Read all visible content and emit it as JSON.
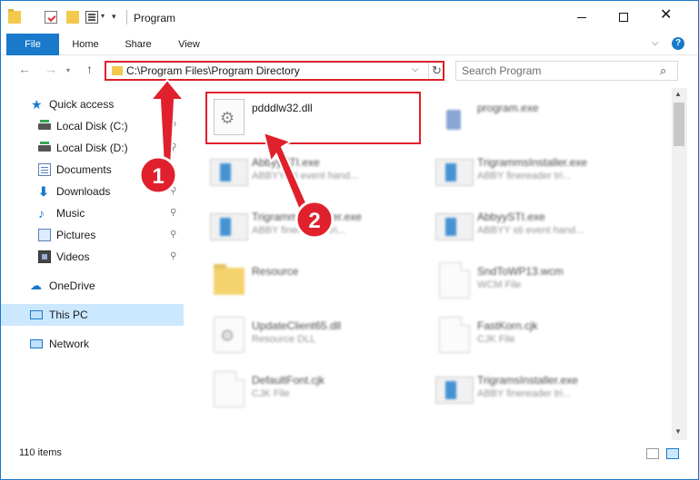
{
  "window": {
    "title": "Program",
    "min_glyph": "",
    "close_glyph": "✕"
  },
  "ribbon": {
    "tabs": [
      {
        "label": "File"
      },
      {
        "label": "Home"
      },
      {
        "label": "Share"
      },
      {
        "label": "View"
      }
    ],
    "help_glyph": "?"
  },
  "nav": {
    "back_glyph": "←",
    "forward_glyph": "→",
    "recent_glyph": "▾",
    "up_glyph": "↑"
  },
  "address": {
    "path": "C:\\Program Files\\Program Directory",
    "dropdown_glyph": "⌵",
    "refresh_glyph": "↻"
  },
  "search": {
    "placeholder": "Search Program",
    "icon_glyph": "⌕"
  },
  "sidebar": {
    "items": [
      {
        "label": "Quick access",
        "icon": "star-icon"
      },
      {
        "label": "Local Disk (C:)",
        "icon": "drive-icon",
        "pinned": true
      },
      {
        "label": "Local Disk (D:)",
        "icon": "drive-icon",
        "pinned": true
      },
      {
        "label": "Documents",
        "icon": "documents-icon",
        "pinned": true
      },
      {
        "label": "Downloads",
        "icon": "download-icon",
        "pinned": true
      },
      {
        "label": "Music",
        "icon": "music-icon",
        "pinned": true
      },
      {
        "label": "Pictures",
        "icon": "pictures-icon",
        "pinned": true
      },
      {
        "label": "Videos",
        "icon": "videos-icon",
        "pinned": true
      },
      {
        "label": "OneDrive",
        "icon": "cloud-icon"
      },
      {
        "label": "This PC",
        "icon": "computer-icon",
        "selected": true
      },
      {
        "label": "Network",
        "icon": "network-icon"
      }
    ],
    "pin_glyph": "📌",
    "star_glyph": "★",
    "download_glyph": "⬇",
    "music_glyph": "♪",
    "cloud_glyph": "☁"
  },
  "files": [
    {
      "name": "pdddlw32.dll",
      "sub": "",
      "icon": "gear-file-icon"
    },
    {
      "name": "program.exe",
      "sub": "",
      "icon": "exe-icon"
    },
    {
      "name": "AbbyySTI.exe",
      "sub": "ABBYY sti event hand...",
      "icon": "app-icon"
    },
    {
      "name": "TrigrammsInstaller.exe",
      "sub": "ABBY finereader tri...",
      "icon": "app-icon"
    },
    {
      "name": "TrigrammsInstaller.exe",
      "sub": "ABBY finereader tri...",
      "icon": "app-icon"
    },
    {
      "name": "AbbyySTI.exe",
      "sub": "ABBYY sti event hand...",
      "icon": "app-icon"
    },
    {
      "name": "Resource",
      "sub": "",
      "icon": "folder-icon"
    },
    {
      "name": "SndToWP13.wcm",
      "sub": "WCM File",
      "icon": "document-icon"
    },
    {
      "name": "UpdateClient65.dll",
      "sub": "Resource DLL",
      "icon": "gear-file-icon"
    },
    {
      "name": "FastKorn.cjk",
      "sub": "CJK File",
      "icon": "document-icon"
    },
    {
      "name": "DefaultFont.cjk",
      "sub": "CJK File",
      "icon": "document-icon"
    },
    {
      "name": "TrigramsInstaller.exe",
      "sub": "ABBY finereader tri...",
      "icon": "app-icon"
    }
  ],
  "scrollbar": {
    "up_glyph": "▲",
    "down_glyph": "▼"
  },
  "status": {
    "item_count": "110 items"
  },
  "annotations": {
    "badge_1": "1",
    "badge_2": "2",
    "color": "#e0202c"
  },
  "colors": {
    "accent": "#1979ca",
    "selected_bg": "#cce8ff",
    "highlight": "#e0202c",
    "folder": "#f2c94c"
  }
}
